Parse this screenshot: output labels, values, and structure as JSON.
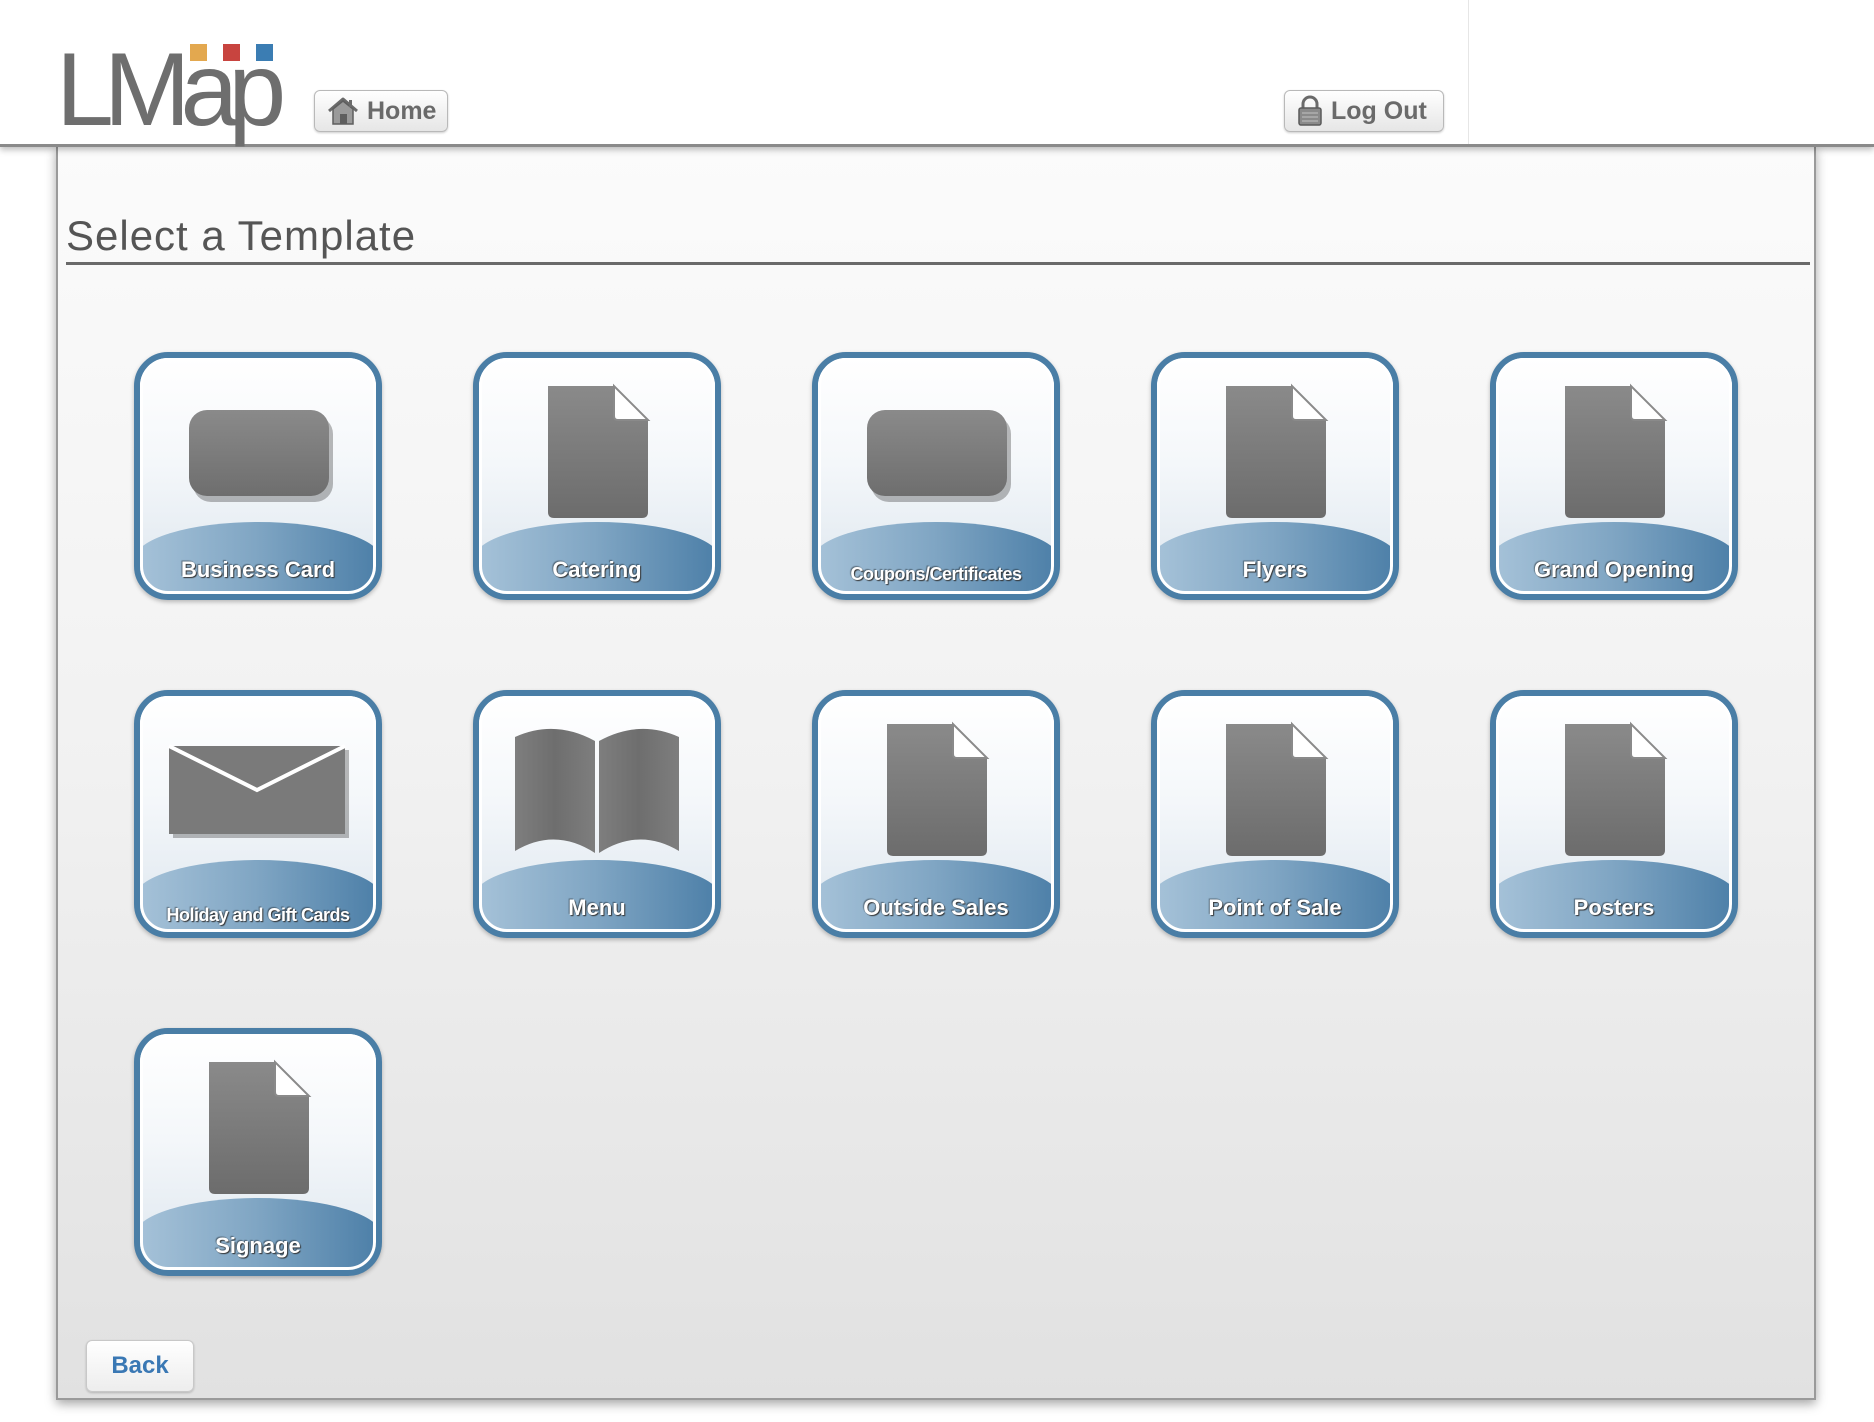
{
  "app": {
    "logo_text": "LMap",
    "logo_colors": [
      "#e3a84f",
      "#c8443f",
      "#3b7db3"
    ]
  },
  "header": {
    "home_label": "Home",
    "home_icon": "house-icon",
    "logout_label": "Log Out",
    "logout_icon": "lock-icon"
  },
  "main": {
    "title": "Select a Template",
    "templates": [
      {
        "label": "Business Card",
        "icon": "card-icon"
      },
      {
        "label": "Catering",
        "icon": "document-icon"
      },
      {
        "label": "Coupons/Certificates",
        "icon": "card-icon"
      },
      {
        "label": "Flyers",
        "icon": "document-icon"
      },
      {
        "label": "Grand Opening",
        "icon": "document-icon"
      },
      {
        "label": "Holiday and Gift Cards",
        "icon": "envelope-icon"
      },
      {
        "label": "Menu",
        "icon": "book-icon"
      },
      {
        "label": "Outside Sales",
        "icon": "document-icon"
      },
      {
        "label": "Point of Sale",
        "icon": "document-icon"
      },
      {
        "label": "Posters",
        "icon": "document-icon"
      },
      {
        "label": "Signage",
        "icon": "document-icon"
      }
    ],
    "back_label": "Back"
  },
  "colors": {
    "tile_border": "#4a7ea6",
    "icon_gray": "#7a7a7a",
    "back_text": "#3a78b4"
  }
}
